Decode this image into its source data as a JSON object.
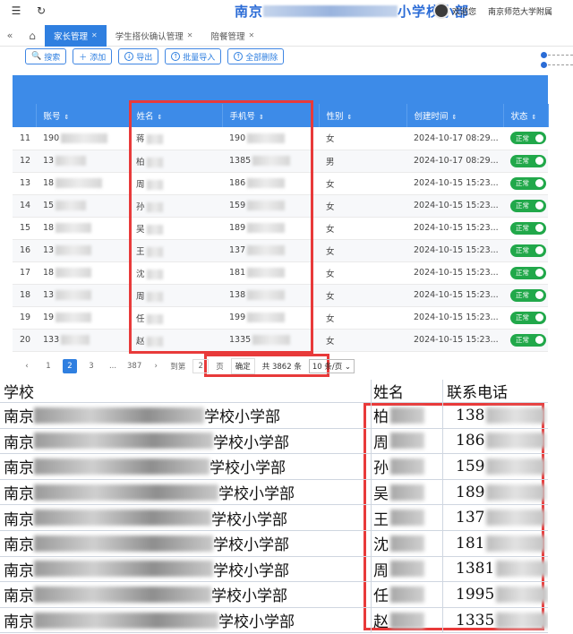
{
  "topbar": {
    "brand_prefix": "南京",
    "brand_suffix": "小学校小",
    "brand_end": "部",
    "welcome": "欢迎您",
    "school": "南京师范大学附属"
  },
  "tabs": [
    {
      "label": "家长管理",
      "active": true
    },
    {
      "label": "学生搭伙确认管理",
      "active": false
    },
    {
      "label": "陪餐管理",
      "active": false
    }
  ],
  "toolbar": {
    "search": "搜索",
    "add": "添加",
    "export": "导出",
    "batch_import": "批量导入",
    "delete_all": "全部删除"
  },
  "table": {
    "headers": [
      "账号",
      "姓名",
      "手机号",
      "性别",
      "创建时间",
      "状态"
    ],
    "rows": [
      {
        "idx": "11",
        "account": "190",
        "name": "蒋",
        "phone": "190",
        "gender": "女",
        "created": "2024-10-17 08:29...",
        "status": "正常"
      },
      {
        "idx": "12",
        "account": "13",
        "name": "柏",
        "phone": "1385",
        "gender": "男",
        "created": "2024-10-17 08:29...",
        "status": "正常"
      },
      {
        "idx": "13",
        "account": "18",
        "name": "周",
        "phone": "186",
        "gender": "女",
        "created": "2024-10-15 15:23...",
        "status": "正常"
      },
      {
        "idx": "14",
        "account": "15",
        "name": "孙",
        "phone": "159",
        "gender": "女",
        "created": "2024-10-15 15:23...",
        "status": "正常"
      },
      {
        "idx": "15",
        "account": "18",
        "name": "吴",
        "phone": "189",
        "gender": "女",
        "created": "2024-10-15 15:23...",
        "status": "正常"
      },
      {
        "idx": "16",
        "account": "13",
        "name": "王",
        "phone": "137",
        "gender": "女",
        "created": "2024-10-15 15:23...",
        "status": "正常"
      },
      {
        "idx": "17",
        "account": "18",
        "name": "沈",
        "phone": "181",
        "gender": "女",
        "created": "2024-10-15 15:23...",
        "status": "正常"
      },
      {
        "idx": "18",
        "account": "13",
        "name": "周",
        "phone": "138",
        "gender": "女",
        "created": "2024-10-15 15:23...",
        "status": "正常"
      },
      {
        "idx": "19",
        "account": "19",
        "name": "任",
        "phone": "199",
        "gender": "女",
        "created": "2024-10-15 15:23...",
        "status": "正常"
      },
      {
        "idx": "20",
        "account": "133",
        "name": "赵",
        "phone": "1335",
        "gender": "女",
        "created": "2024-10-15 15:23...",
        "status": "正常"
      }
    ]
  },
  "pager": {
    "prev": "‹",
    "pages": [
      "1",
      "2",
      "3",
      "...",
      "387"
    ],
    "active_page": "2",
    "next": "›",
    "goto_label": "到第",
    "goto_value": "2",
    "page_suffix": "页",
    "confirm": "确定",
    "total": "共 3862 条",
    "page_size": "10 条/页"
  },
  "sheet": {
    "headers": {
      "school": "学校",
      "name": "姓名",
      "phone": "联系电话"
    },
    "school_prefix": "南京",
    "school_suffix": "学校小学部",
    "rows": [
      {
        "school_suffix": "学校小学部",
        "name": "柏",
        "phone": "138"
      },
      {
        "school_suffix": "学校小学部",
        "name": "周",
        "phone": "186"
      },
      {
        "school_suffix": "学校小学部",
        "name": "孙",
        "phone": "159"
      },
      {
        "school_suffix": "学校小学部",
        "name": "吴",
        "phone": "189"
      },
      {
        "school_suffix": "学校小学部",
        "name": "王",
        "phone": "137"
      },
      {
        "school_suffix": "学校小学部",
        "name": "沈",
        "phone": "181"
      },
      {
        "school_suffix": "学校小学部",
        "name": "周",
        "phone": "1381"
      },
      {
        "school_suffix": "学校小学部",
        "name": "任",
        "phone": "1995"
      },
      {
        "school_suffix": "学校小学部",
        "name": "赵",
        "phone": "1335"
      }
    ]
  },
  "colors": {
    "primary": "#2f7fe0",
    "header": "#3d8be8",
    "status": "#21a84a",
    "highlight": "#e83a3a"
  }
}
